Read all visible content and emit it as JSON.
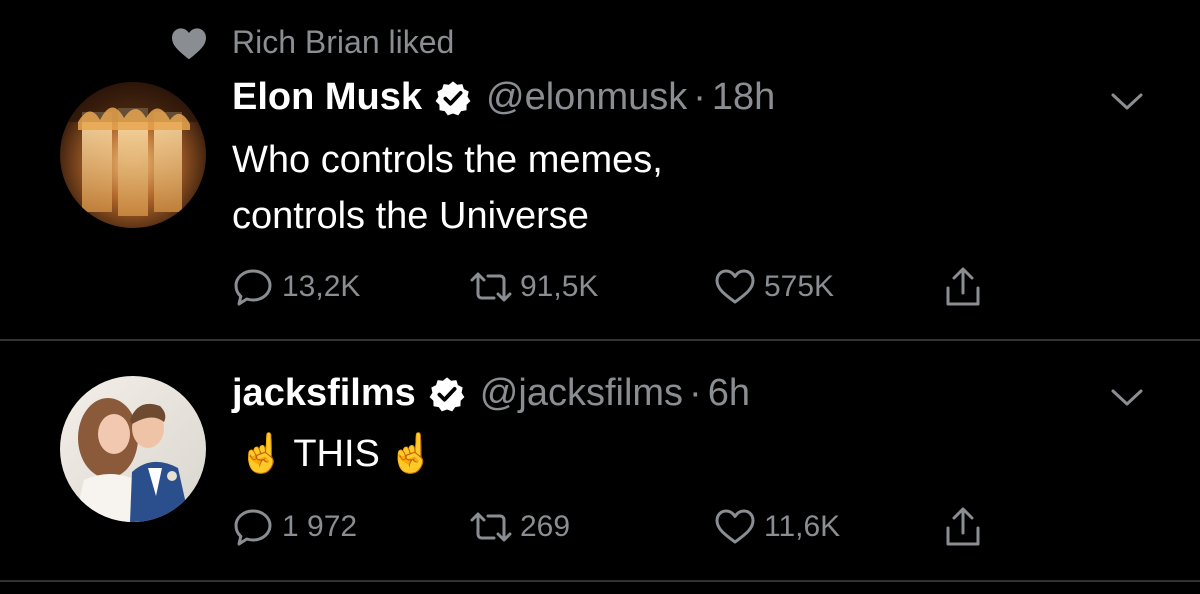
{
  "social_context": {
    "text": "Rich Brian liked",
    "icon": "heart-filled-icon"
  },
  "tweets": [
    {
      "name": "Elon Musk",
      "handle": "@elonmusk",
      "separator": "·",
      "time": "18h",
      "text_lines": [
        "Who controls the memes,",
        "controls the Universe"
      ],
      "stats": {
        "replies": "13,2K",
        "retweets": "91,5K",
        "likes": "575K"
      },
      "avatar": "flame-burning-avatar"
    },
    {
      "name": "jacksfilms",
      "handle": "@jacksfilms",
      "separator": "·",
      "time": "6h",
      "text": "THIS",
      "emoji": "☝️",
      "stats": {
        "replies": "1 972",
        "retweets": "269",
        "likes": "11,6K"
      },
      "avatar": "wedding-couple-avatar"
    }
  ],
  "colors": {
    "background": "#000000",
    "text_primary": "#ffffff",
    "text_secondary": "#8a8d91",
    "divider": "#2f3336",
    "verified_badge": "#ffffff"
  }
}
